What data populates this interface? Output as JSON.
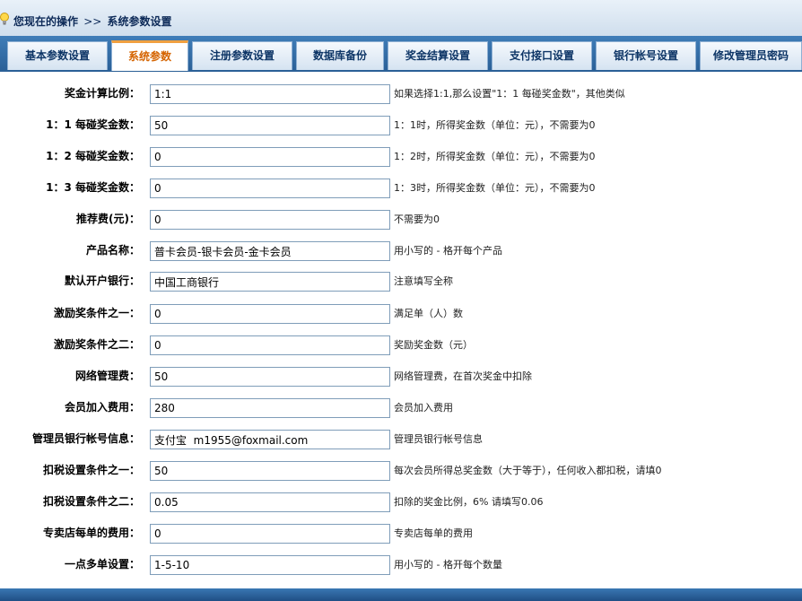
{
  "breadcrumb": {
    "label": "您现在的操作",
    "separator": ">>",
    "current": "系统参数设置"
  },
  "tabs": [
    {
      "label": "基本参数设置",
      "active": false
    },
    {
      "label": "系统参数",
      "active": true
    },
    {
      "label": "注册参数设置",
      "active": false
    },
    {
      "label": "数据库备份",
      "active": false
    },
    {
      "label": "奖金结算设置",
      "active": false
    },
    {
      "label": "支付接口设置",
      "active": false
    },
    {
      "label": "银行帐号设置",
      "active": false
    },
    {
      "label": "修改管理员密码",
      "active": false
    }
  ],
  "form": {
    "rows": [
      {
        "label": "奖金计算比例：",
        "value": "1:1",
        "hint": "如果选择1:1,那么设置\"1：1 每碰奖金数\"，其他类似"
      },
      {
        "label": "1：1 每碰奖金数：",
        "value": "50",
        "hint": "1：1时，所得奖金数（单位：元），不需要为0"
      },
      {
        "label": "1：2 每碰奖金数：",
        "value": "0",
        "hint": "1：2时，所得奖金数（单位：元），不需要为0"
      },
      {
        "label": "1：3 每碰奖金数：",
        "value": "0",
        "hint": "1：3时，所得奖金数（单位：元），不需要为0"
      },
      {
        "label": "推荐费(元)：",
        "value": "0",
        "hint": "不需要为0"
      },
      {
        "label": "产品名称：",
        "value": "普卡会员-银卡会员-金卡会员",
        "hint": "用小写的 - 格开每个产品"
      },
      {
        "label": "默认开户银行：",
        "value": "中国工商银行",
        "hint": "注意填写全称"
      },
      {
        "label": "激励奖条件之一：",
        "value": "0",
        "hint": "满足单（人）数"
      },
      {
        "label": "激励奖条件之二：",
        "value": "0",
        "hint": "奖励奖金数（元）"
      },
      {
        "label": "网络管理费：",
        "value": "50",
        "hint": "网络管理费，在首次奖金中扣除"
      },
      {
        "label": "会员加入费用：",
        "value": "280",
        "hint": "会员加入费用"
      },
      {
        "label": "管理员银行帐号信息：",
        "value": "支付宝  m1955@foxmail.com",
        "hint": "管理员银行帐号信息"
      },
      {
        "label": "扣税设置条件之一：",
        "value": "50",
        "hint": "每次会员所得总奖金数（大于等于），任何收入都扣税，请填0"
      },
      {
        "label": "扣税设置条件之二：",
        "value": "0.05",
        "hint": "扣除的奖金比例，6% 请填写0.06"
      },
      {
        "label": "专卖店每单的费用：",
        "value": "0",
        "hint": "专卖店每单的费用"
      },
      {
        "label": "一点多单设置：",
        "value": "1-5-10",
        "hint": "用小写的 - 格开每个数量"
      }
    ]
  },
  "colors": {
    "tab_active_text": "#d56400",
    "tab_text": "#0d3566",
    "tabstrip_bg": "#2f6aa4",
    "input_border": "#7f9db9"
  },
  "icons": {
    "breadcrumb": "lightbulb-icon"
  }
}
